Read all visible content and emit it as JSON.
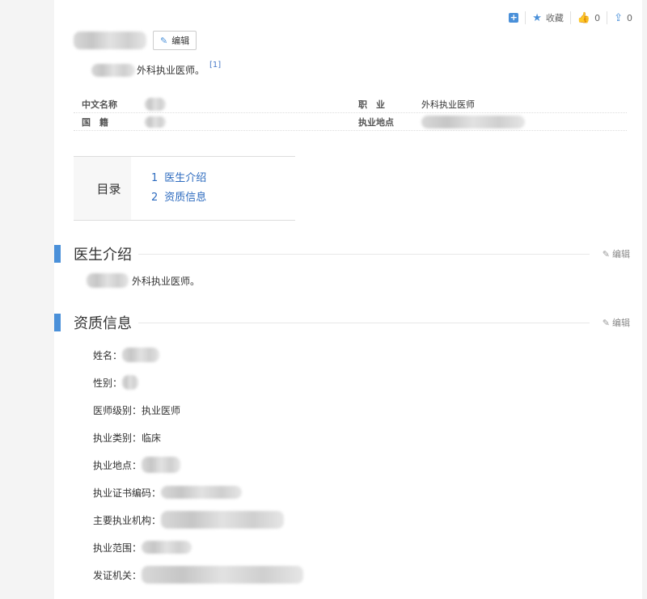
{
  "toolbar": {
    "favorite_label": "收藏",
    "like_count": "0",
    "share_count": "0"
  },
  "header": {
    "edit_label": "编辑"
  },
  "summary": {
    "text": "外科执业医师。",
    "ref": "[1]"
  },
  "basic_info": {
    "row1": {
      "left_name": "中文名称",
      "right_name": "职　业",
      "right_value": "外科执业医师"
    },
    "row2": {
      "left_name": "国　籍",
      "right_name": "执业地点"
    }
  },
  "toc": {
    "heading": "目录",
    "items": [
      {
        "num": "1",
        "label": "医生介绍"
      },
      {
        "num": "2",
        "label": "资质信息"
      }
    ]
  },
  "sections": {
    "intro": {
      "title": "医生介绍",
      "edit_label": "编辑",
      "text": "外科执业医师。"
    },
    "qualification": {
      "title": "资质信息",
      "edit_label": "编辑"
    }
  },
  "qualification_fields": {
    "name": "姓名：",
    "gender": "性别：",
    "level": "医师级别：执业医师",
    "category": "执业类别：临床",
    "location": "执业地点：",
    "cert": "执业证书编码：",
    "institution": "主要执业机构：",
    "scope": "执业范围：",
    "issuer": "发证机关："
  }
}
